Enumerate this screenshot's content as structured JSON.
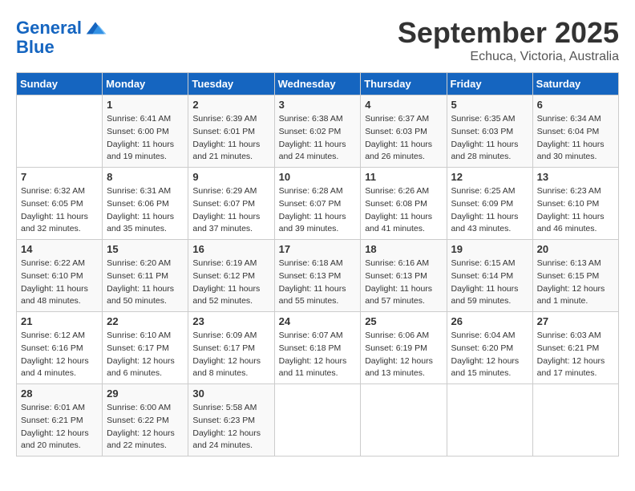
{
  "header": {
    "logo_line1": "General",
    "logo_line2": "Blue",
    "month": "September 2025",
    "location": "Echuca, Victoria, Australia"
  },
  "weekdays": [
    "Sunday",
    "Monday",
    "Tuesday",
    "Wednesday",
    "Thursday",
    "Friday",
    "Saturday"
  ],
  "weeks": [
    [
      {
        "day": "",
        "info": ""
      },
      {
        "day": "1",
        "info": "Sunrise: 6:41 AM\nSunset: 6:00 PM\nDaylight: 11 hours\nand 19 minutes."
      },
      {
        "day": "2",
        "info": "Sunrise: 6:39 AM\nSunset: 6:01 PM\nDaylight: 11 hours\nand 21 minutes."
      },
      {
        "day": "3",
        "info": "Sunrise: 6:38 AM\nSunset: 6:02 PM\nDaylight: 11 hours\nand 24 minutes."
      },
      {
        "day": "4",
        "info": "Sunrise: 6:37 AM\nSunset: 6:03 PM\nDaylight: 11 hours\nand 26 minutes."
      },
      {
        "day": "5",
        "info": "Sunrise: 6:35 AM\nSunset: 6:03 PM\nDaylight: 11 hours\nand 28 minutes."
      },
      {
        "day": "6",
        "info": "Sunrise: 6:34 AM\nSunset: 6:04 PM\nDaylight: 11 hours\nand 30 minutes."
      }
    ],
    [
      {
        "day": "7",
        "info": "Sunrise: 6:32 AM\nSunset: 6:05 PM\nDaylight: 11 hours\nand 32 minutes."
      },
      {
        "day": "8",
        "info": "Sunrise: 6:31 AM\nSunset: 6:06 PM\nDaylight: 11 hours\nand 35 minutes."
      },
      {
        "day": "9",
        "info": "Sunrise: 6:29 AM\nSunset: 6:07 PM\nDaylight: 11 hours\nand 37 minutes."
      },
      {
        "day": "10",
        "info": "Sunrise: 6:28 AM\nSunset: 6:07 PM\nDaylight: 11 hours\nand 39 minutes."
      },
      {
        "day": "11",
        "info": "Sunrise: 6:26 AM\nSunset: 6:08 PM\nDaylight: 11 hours\nand 41 minutes."
      },
      {
        "day": "12",
        "info": "Sunrise: 6:25 AM\nSunset: 6:09 PM\nDaylight: 11 hours\nand 43 minutes."
      },
      {
        "day": "13",
        "info": "Sunrise: 6:23 AM\nSunset: 6:10 PM\nDaylight: 11 hours\nand 46 minutes."
      }
    ],
    [
      {
        "day": "14",
        "info": "Sunrise: 6:22 AM\nSunset: 6:10 PM\nDaylight: 11 hours\nand 48 minutes."
      },
      {
        "day": "15",
        "info": "Sunrise: 6:20 AM\nSunset: 6:11 PM\nDaylight: 11 hours\nand 50 minutes."
      },
      {
        "day": "16",
        "info": "Sunrise: 6:19 AM\nSunset: 6:12 PM\nDaylight: 11 hours\nand 52 minutes."
      },
      {
        "day": "17",
        "info": "Sunrise: 6:18 AM\nSunset: 6:13 PM\nDaylight: 11 hours\nand 55 minutes."
      },
      {
        "day": "18",
        "info": "Sunrise: 6:16 AM\nSunset: 6:13 PM\nDaylight: 11 hours\nand 57 minutes."
      },
      {
        "day": "19",
        "info": "Sunrise: 6:15 AM\nSunset: 6:14 PM\nDaylight: 11 hours\nand 59 minutes."
      },
      {
        "day": "20",
        "info": "Sunrise: 6:13 AM\nSunset: 6:15 PM\nDaylight: 12 hours\nand 1 minute."
      }
    ],
    [
      {
        "day": "21",
        "info": "Sunrise: 6:12 AM\nSunset: 6:16 PM\nDaylight: 12 hours\nand 4 minutes."
      },
      {
        "day": "22",
        "info": "Sunrise: 6:10 AM\nSunset: 6:17 PM\nDaylight: 12 hours\nand 6 minutes."
      },
      {
        "day": "23",
        "info": "Sunrise: 6:09 AM\nSunset: 6:17 PM\nDaylight: 12 hours\nand 8 minutes."
      },
      {
        "day": "24",
        "info": "Sunrise: 6:07 AM\nSunset: 6:18 PM\nDaylight: 12 hours\nand 11 minutes."
      },
      {
        "day": "25",
        "info": "Sunrise: 6:06 AM\nSunset: 6:19 PM\nDaylight: 12 hours\nand 13 minutes."
      },
      {
        "day": "26",
        "info": "Sunrise: 6:04 AM\nSunset: 6:20 PM\nDaylight: 12 hours\nand 15 minutes."
      },
      {
        "day": "27",
        "info": "Sunrise: 6:03 AM\nSunset: 6:21 PM\nDaylight: 12 hours\nand 17 minutes."
      }
    ],
    [
      {
        "day": "28",
        "info": "Sunrise: 6:01 AM\nSunset: 6:21 PM\nDaylight: 12 hours\nand 20 minutes."
      },
      {
        "day": "29",
        "info": "Sunrise: 6:00 AM\nSunset: 6:22 PM\nDaylight: 12 hours\nand 22 minutes."
      },
      {
        "day": "30",
        "info": "Sunrise: 5:58 AM\nSunset: 6:23 PM\nDaylight: 12 hours\nand 24 minutes."
      },
      {
        "day": "",
        "info": ""
      },
      {
        "day": "",
        "info": ""
      },
      {
        "day": "",
        "info": ""
      },
      {
        "day": "",
        "info": ""
      }
    ]
  ]
}
